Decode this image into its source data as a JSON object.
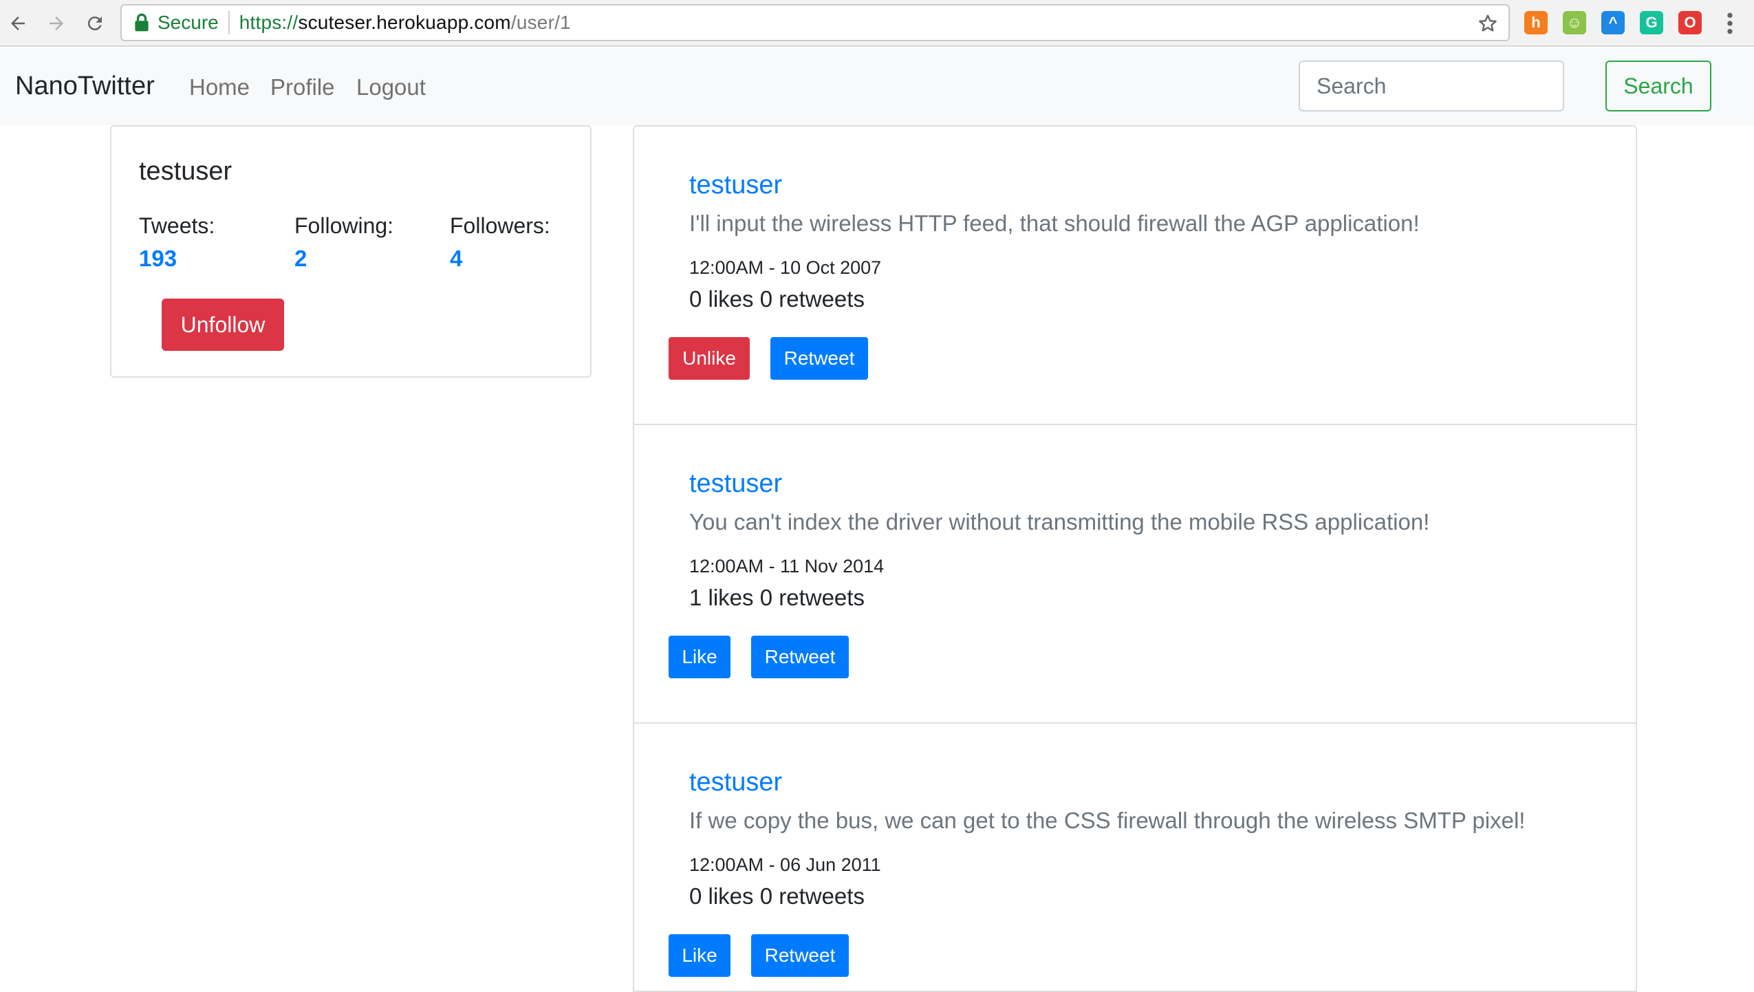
{
  "browser": {
    "secure_label": "Secure",
    "url_scheme": "https://",
    "url_host": "scuteser.herokuapp.com",
    "url_path": "/user/1",
    "extensions": [
      {
        "icon": "honey-extension-icon",
        "glyph": "h",
        "color": "#f57e20"
      },
      {
        "icon": "tampermonkey-extension-icon",
        "glyph": "☺",
        "color": "#8bc34a"
      },
      {
        "icon": "analytics-extension-icon",
        "glyph": "^",
        "color": "#1e88e5"
      },
      {
        "icon": "grammarly-extension-icon",
        "glyph": "G",
        "color": "#15c39a"
      },
      {
        "icon": "opera-extension-icon",
        "glyph": "O",
        "color": "#e53935"
      }
    ]
  },
  "navbar": {
    "brand": "NanoTwitter",
    "links": [
      "Home",
      "Profile",
      "Logout"
    ],
    "search_placeholder": "Search",
    "search_button": "Search"
  },
  "profile": {
    "username": "testuser",
    "stats": [
      {
        "label": "Tweets:",
        "value": "193"
      },
      {
        "label": "Following:",
        "value": "2"
      },
      {
        "label": "Followers:",
        "value": "4"
      }
    ],
    "unfollow_label": "Unfollow"
  },
  "tweets": [
    {
      "author": "testuser",
      "text": "I'll input the wireless HTTP feed, that should firewall the AGP application!",
      "time": "12:00AM - 10 Oct 2007",
      "counts": "0 likes 0 retweets",
      "like_label": "Unlike",
      "retweet_label": "Retweet"
    },
    {
      "author": "testuser",
      "text": "You can't index the driver without transmitting the mobile RSS application!",
      "time": "12:00AM - 11 Nov 2014",
      "counts": "1 likes 0 retweets",
      "like_label": "Like",
      "retweet_label": "Retweet"
    },
    {
      "author": "testuser",
      "text": "If we copy the bus, we can get to the CSS firewall through the wireless SMTP pixel!",
      "time": "12:00AM - 06 Jun 2011",
      "counts": "0 likes 0 retweets",
      "like_label": "Like",
      "retweet_label": "Retweet"
    }
  ],
  "colors": {
    "primary": "#007bff",
    "danger": "#dc3545",
    "success": "#28a745",
    "muted": "#6c757d"
  }
}
